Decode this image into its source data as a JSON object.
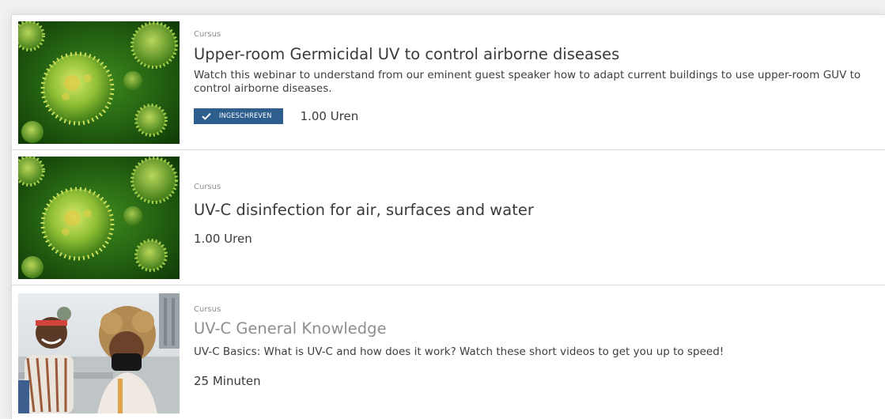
{
  "courses": [
    {
      "type": "Cursus",
      "title": "Upper-room Germicidal UV to control airborne diseases",
      "description": "Watch this webinar to understand from our eminent guest speaker how to adapt current buildings to use upper-room GUV to control airborne diseases.",
      "badge": "INGESCHREVEN",
      "duration": "1.00 Uren",
      "thumbnail_icon": "virus-image"
    },
    {
      "type": "Cursus",
      "title": "UV-C disinfection for air, surfaces and water",
      "duration": "1.00 Uren",
      "thumbnail_icon": "virus-image"
    },
    {
      "type": "Cursus",
      "title": "UV-C General Knowledge",
      "description": "UV-C Basics: What is UV-C and how does it work? Watch these short videos to get you up to speed!",
      "duration": "25 Minuten",
      "thumbnail_icon": "people-photo"
    }
  ],
  "colors": {
    "badge_bg": "#2e5e8e",
    "virus_green": "#5a9e2a",
    "background_green": "#1f5a12"
  }
}
